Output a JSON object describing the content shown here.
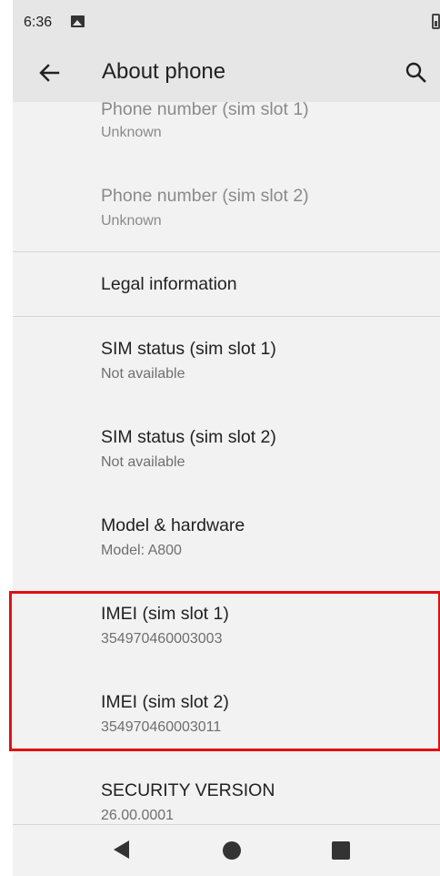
{
  "status_bar": {
    "time": "6:36"
  },
  "app_bar": {
    "title": "About phone"
  },
  "items": [
    {
      "title": "Phone number (sim slot 1)",
      "subtitle": "Unknown"
    },
    {
      "title": "Phone number (sim slot 2)",
      "subtitle": "Unknown"
    },
    {
      "title": "Legal information"
    },
    {
      "title": "SIM status (sim slot 1)",
      "subtitle": "Not available"
    },
    {
      "title": "SIM status (sim slot 2)",
      "subtitle": "Not available"
    },
    {
      "title": "Model & hardware",
      "subtitle": "Model: A800"
    },
    {
      "title": "IMEI (sim slot 1)",
      "subtitle": "354970460003003"
    },
    {
      "title": "IMEI (sim slot 2)",
      "subtitle": "354970460003011"
    },
    {
      "title": "SECURITY VERSION",
      "subtitle": "26.00.0001"
    }
  ],
  "colors": {
    "highlight": "#e01010",
    "app_bar_bg": "#e6e6e6",
    "page_bg": "#f2f2f2"
  }
}
